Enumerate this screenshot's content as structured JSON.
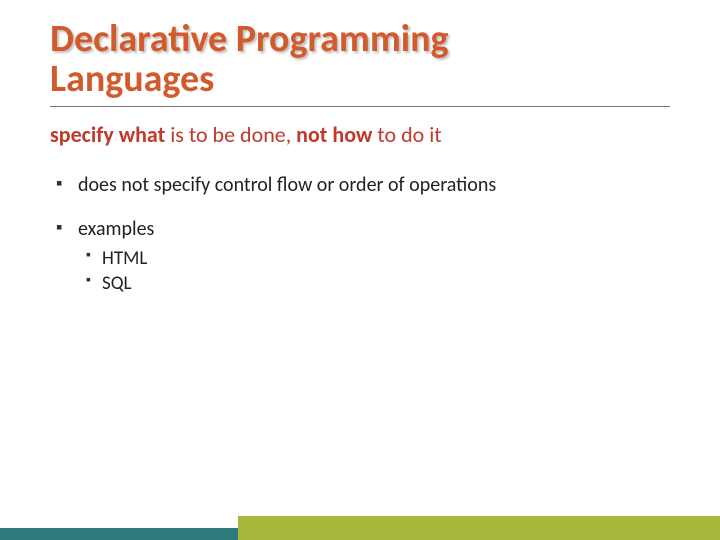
{
  "title": {
    "word1": "Declarative",
    "word2": "Programming",
    "word3": "Languages"
  },
  "subtitle": {
    "part1": "specify what",
    "part2": " is to be done, ",
    "part3": "not how",
    "part4": " to do it"
  },
  "bullets": [
    {
      "text": "does not specify control flow or order of operations"
    },
    {
      "text": "examples",
      "children": [
        "HTML",
        "SQL"
      ]
    }
  ],
  "colors": {
    "accent": "#d35a2b",
    "footer_olive": "#a7b83c",
    "footer_teal": "#2f7a7a"
  }
}
